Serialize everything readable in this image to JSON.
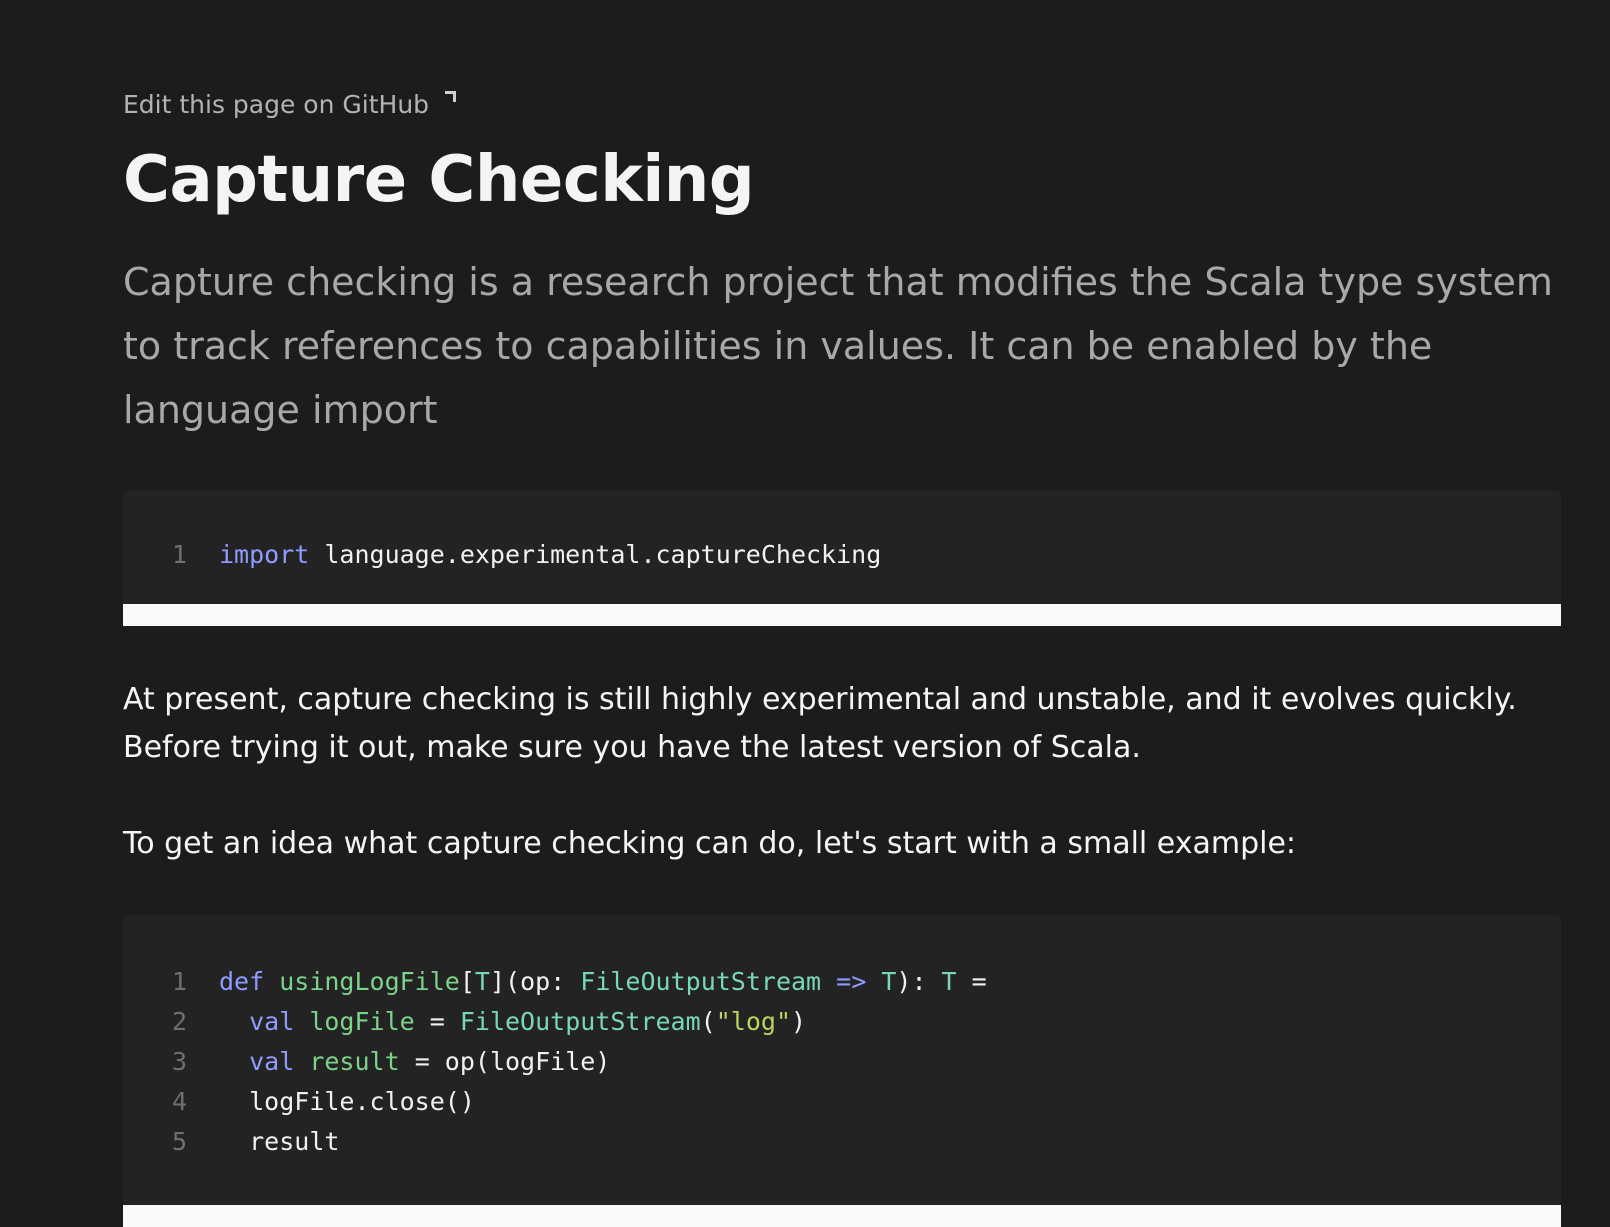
{
  "header": {
    "edit_link": "Edit this page on GitHub",
    "edit_icon": "external-link-icon"
  },
  "title": "Capture Checking",
  "lead": "Capture checking is a research project that modifies the Scala type system to track references to capabilities in values. It can be enabled by the language import",
  "code_block_1": {
    "lines": [
      {
        "no": "1",
        "kw": "import",
        "rest": " language.experimental.captureChecking"
      }
    ]
  },
  "paragraphs": {
    "p1": "At present, capture checking is still highly experimental and unstable, and it evolves quickly. Before trying it out, make sure you have the latest version of Scala.",
    "p2": "To get an idea what capture checking can do, let's start with a small example:"
  },
  "code_block_2": {
    "line_numbers": [
      "1",
      "2",
      "3",
      "4",
      "5"
    ],
    "line1": {
      "kw": "def",
      "name": "usingLogFile",
      "lb": "[",
      "t1": "T",
      "rb": "](op: ",
      "type": "FileOutputStream",
      "arrow": " =>",
      "t2": "T",
      "close": "): ",
      "t3": "T",
      "eq": " ="
    },
    "line2": {
      "kw": "val",
      "name": "logFile",
      "eq": " = ",
      "type": "FileOutputStream",
      "open": "(",
      "str": "\"log\"",
      "close": ")"
    },
    "line3": {
      "kw": "val",
      "name": "result",
      "rest": " = op(logFile)"
    },
    "line4": "logFile.close()",
    "line5": "result"
  },
  "colors": {
    "background": "#1c1c1c",
    "code_background": "#232323",
    "keyword": "#8e9cff",
    "function": "#7bd389",
    "type": "#78d7b8",
    "string": "#b7d65a"
  }
}
